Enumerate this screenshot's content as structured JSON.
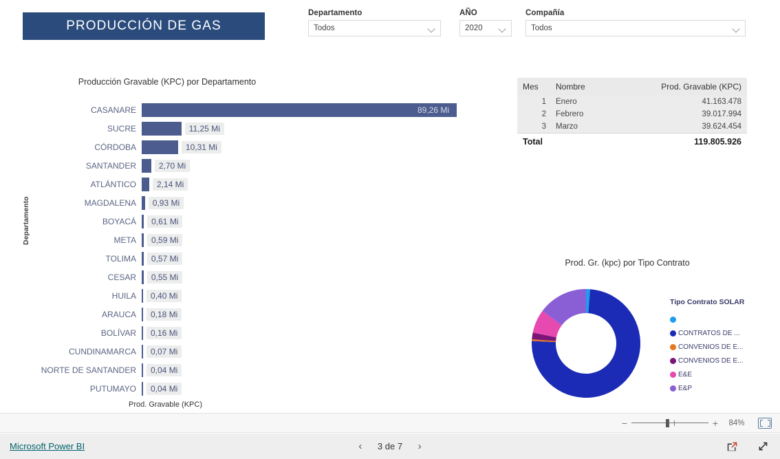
{
  "header": {
    "title": "PRODUCCIÓN DE GAS",
    "banner_color": "#2a4b7c",
    "filters": [
      {
        "label": "Departamento",
        "value": "Todos",
        "icon": "chevron-down-icon"
      },
      {
        "label": "AÑO",
        "value": "2020",
        "icon": "chevron-down-icon"
      },
      {
        "label": "Compañía",
        "value": "Todos",
        "icon": "chevron-down-icon"
      }
    ]
  },
  "chart_data": [
    {
      "type": "bar",
      "orientation": "horizontal",
      "title": "Producción Gravable (KPC) por Departamento",
      "xlabel": "Prod. Gravable (KPC)",
      "ylabel": "Departamento",
      "bar_color": "#4c5c8f",
      "unit_suffix": "Mi",
      "xlim": [
        0,
        89.26
      ],
      "categories": [
        "CASANARE",
        "SUCRE",
        "CÓRDOBA",
        "SANTANDER",
        "ATLÁNTICO",
        "MAGDALENA",
        "BOYACÁ",
        "META",
        "TOLIMA",
        "CESAR",
        "HUILA",
        "ARAUCA",
        "BOLÍVAR",
        "CUNDINAMARCA",
        "NORTE DE SANTANDER",
        "PUTUMAYO"
      ],
      "values": [
        89.26,
        11.25,
        10.31,
        2.7,
        2.14,
        0.93,
        0.61,
        0.59,
        0.57,
        0.55,
        0.4,
        0.18,
        0.16,
        0.07,
        0.04,
        0.04
      ],
      "labels": [
        "89,26 Mi",
        "11,25 Mi",
        "10,31 Mi",
        "2,70 Mi",
        "2,14 Mi",
        "0,93 Mi",
        "0,61 Mi",
        "0,59 Mi",
        "0,57 Mi",
        "0,55 Mi",
        "0,40 Mi",
        "0,18 Mi",
        "0,16 Mi",
        "0,07 Mi",
        "0,04 Mi",
        "0,04 Mi"
      ]
    },
    {
      "type": "pie",
      "variant": "donut",
      "title": "Prod. Gr. (kpc) por Tipo Contrato",
      "legend_title": "Tipo Contrato SOLAR",
      "legend_position": "right",
      "labels": [
        "",
        "CONTRATOS DE ...",
        "CONVENIOS DE E...",
        "CONVENIOS DE E...",
        "E&E",
        "E&P"
      ],
      "colors": [
        "#1f9cf0",
        "#1b2bb5",
        "#e8761f",
        "#7b1577",
        "#e649b0",
        "#8a5fd6"
      ],
      "values": [
        1.2,
        74.5,
        0.5,
        2.0,
        7.0,
        14.8
      ]
    }
  ],
  "table": {
    "columns": [
      "Mes",
      "Nombre",
      "Prod. Gravable (KPC)"
    ],
    "rows": [
      {
        "mes": "1",
        "nombre": "Enero",
        "valor": "41.163.478"
      },
      {
        "mes": "2",
        "nombre": "Febrero",
        "valor": "39.017.994"
      },
      {
        "mes": "3",
        "nombre": "Marzo",
        "valor": "39.624.454"
      }
    ],
    "total_label": "Total",
    "total_value": "119.805.926"
  },
  "statusbar": {
    "minus": "−",
    "plus": "+",
    "zoom_level": "84%",
    "fit_icon": "fit-to-page-icon"
  },
  "footer": {
    "brand": "Microsoft Power BI",
    "prev_icon": "chevron-left-icon",
    "next_icon": "chevron-right-icon",
    "page_indicator": "3 de 7",
    "share_icon": "share-icon",
    "fullscreen_icon": "fullscreen-icon"
  }
}
